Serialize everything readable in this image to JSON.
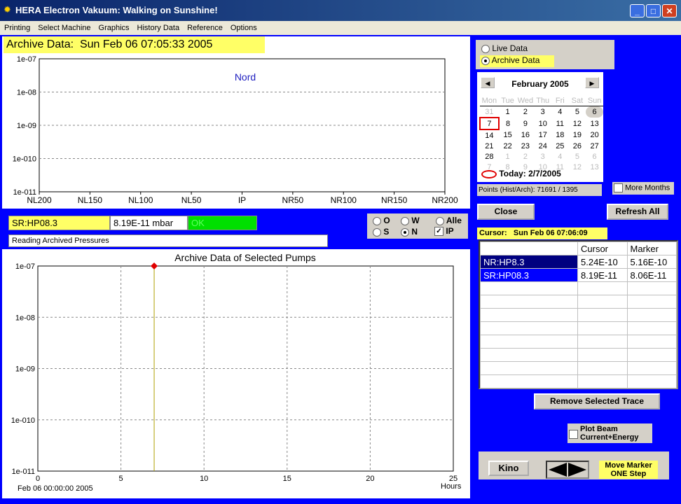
{
  "window": {
    "title": "HERA Electron Vakuum:    Walking on Sunshine!"
  },
  "menu": [
    "Printing",
    "Select Machine",
    "Graphics",
    "History Data",
    "Reference",
    "Options"
  ],
  "archive_header": {
    "label": "Archive Data:",
    "datetime": "Sun Feb 06 07:05:33 2005"
  },
  "top_chart": {
    "annotation": "Nord",
    "y_ticks": [
      "1e-07",
      "1e-08",
      "1e-09",
      "1e-010",
      "1e-011"
    ],
    "x_ticks": [
      "NL200",
      "NL150",
      "NL100",
      "NL50",
      "IP",
      "NR50",
      "NR100",
      "NR150",
      "NR200"
    ],
    "bar_color": "#2e8b2e"
  },
  "pump": {
    "name": "SR:HP08.3",
    "value": "8.19E-11 mbar",
    "status": "OK"
  },
  "status_line": "Reading Archived Pressures",
  "sector_opts": [
    {
      "label": "O",
      "checked": false
    },
    {
      "label": "W",
      "checked": false
    },
    {
      "label": "Alle",
      "checked": false
    },
    {
      "label": "S",
      "checked": false
    },
    {
      "label": "N",
      "checked": true
    }
  ],
  "ip_check": {
    "label": "IP",
    "checked": true
  },
  "bottom_chart": {
    "title": "Archive Data of Selected Pumps",
    "y_ticks": [
      "1e-07",
      "1e-08",
      "1e-09",
      "1e-010",
      "1e-011"
    ],
    "x_ticks": [
      "0",
      "5",
      "10",
      "15",
      "20",
      "25"
    ],
    "x_unit": "Hours",
    "x_start": "Feb 06 00:00:00 2005",
    "marker_hour": 7,
    "line_color": "#0000b0"
  },
  "mode": {
    "live": "Live Data",
    "archive": "Archive Data",
    "selected": "archive"
  },
  "calendar": {
    "month": "February 2005",
    "weekdays": [
      "Mon",
      "Tue",
      "Wed",
      "Thu",
      "Fri",
      "Sat",
      "Sun"
    ],
    "rows": [
      [
        "31",
        "1",
        "2",
        "3",
        "4",
        "5",
        "6"
      ],
      [
        "7",
        "8",
        "9",
        "10",
        "11",
        "12",
        "13"
      ],
      [
        "14",
        "15",
        "16",
        "17",
        "18",
        "19",
        "20"
      ],
      [
        "21",
        "22",
        "23",
        "24",
        "25",
        "26",
        "27"
      ],
      [
        "28",
        "1",
        "2",
        "3",
        "4",
        "5",
        "6"
      ],
      [
        "7",
        "8",
        "9",
        "10",
        "11",
        "12",
        "13"
      ]
    ],
    "today": "Today: 2/7/2005"
  },
  "points": "Points (Hist/Arch): 71691 / 1395",
  "more_months": "More Months",
  "buttons": {
    "close": "Close",
    "refresh": "Refresh All",
    "remove": "Remove Selected Trace",
    "kino": "Kino"
  },
  "cursor": {
    "label": "Cursor:",
    "datetime": "Sun Feb 06 07:06:09"
  },
  "cursor_table": {
    "headers": [
      "",
      "Cursor",
      "Marker"
    ],
    "rows": [
      {
        "name": "NR:HP8.3",
        "cursor": "5.24E-10",
        "marker": "5.16E-10"
      },
      {
        "name": "SR:HP08.3",
        "cursor": "8.19E-11",
        "marker": "8.06E-11"
      }
    ]
  },
  "plot_beam": {
    "line1": "Plot Beam",
    "line2": "Current+Energy"
  },
  "move_marker": {
    "line1": "Move Marker",
    "line2": "ONE Step"
  }
}
